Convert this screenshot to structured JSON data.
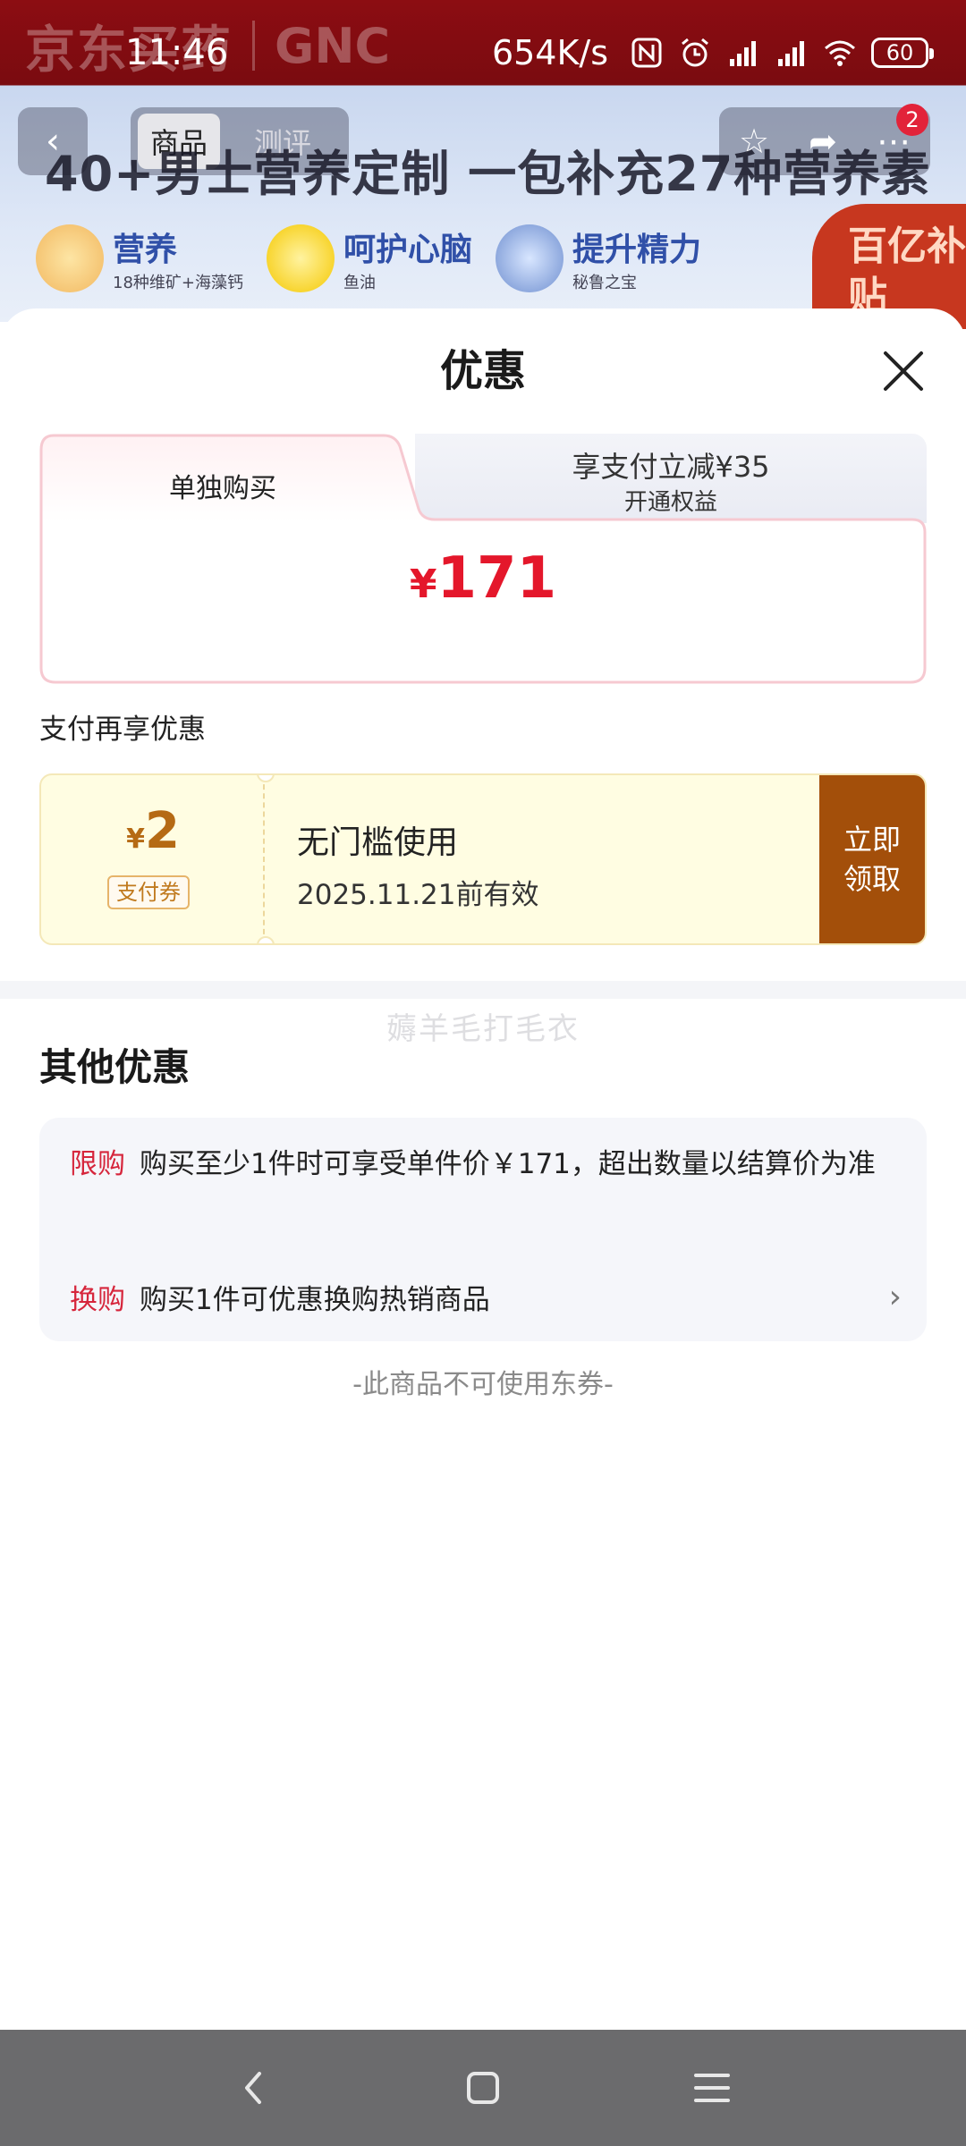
{
  "status_bar": {
    "time": "11:46",
    "net_speed": "654K/s",
    "battery": "60"
  },
  "background": {
    "brand_cn": "京东买药",
    "brand_en": "GNC",
    "tabs": [
      "商品",
      "测评"
    ],
    "badge_count": "2",
    "headline": "40+男士营养定制 一包补充27种营养素",
    "pills": [
      {
        "title": "营养",
        "sub": "18种维矿+海藻钙"
      },
      {
        "title": "呵护心脑",
        "sub": "鱼油"
      },
      {
        "title": "提升精力",
        "sub": "秘鲁之宝"
      }
    ],
    "subsidy": "百亿补贴"
  },
  "sheet": {
    "title": "优惠",
    "tabs": {
      "single_buy": "单独购买",
      "pay_discount_line1": "享支付立减¥35",
      "pay_discount_line2": "开通权益"
    },
    "price_symbol": "¥",
    "price": "171",
    "pay_section_label": "支付再享优惠",
    "coupon": {
      "symbol": "¥",
      "amount": "2",
      "tag": "支付券",
      "condition": "无门槛使用",
      "validity": "2025.11.21前有效",
      "button_line1": "立即",
      "button_line2": "领取"
    },
    "watermark": "薅羊毛打毛衣",
    "other_title": "其他优惠",
    "other_items": [
      {
        "tag": "限购",
        "text": "购买至少1件时可享受单件价￥171，超出数量以结算价为准"
      },
      {
        "tag": "换购",
        "text": "购买1件可优惠换购热销商品"
      }
    ],
    "no_coupon_note": "-此商品不可使用东券-"
  }
}
